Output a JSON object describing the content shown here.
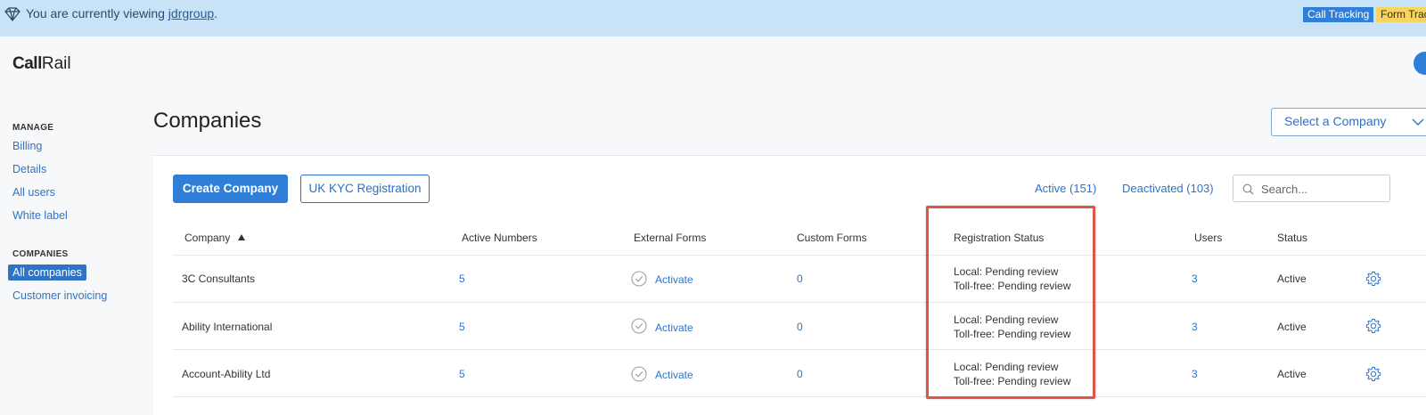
{
  "banner": {
    "prefix": "You are currently viewing",
    "account": "jdrgroup",
    "suffix": ".",
    "tags": [
      "Call Tracking",
      "Form Trac"
    ]
  },
  "brand": {
    "logo_bold": "Call",
    "logo_light": "Rail"
  },
  "sidebar": {
    "manage_heading": "MANAGE",
    "manage_items": [
      "Billing",
      "Details",
      "All users",
      "White label"
    ],
    "companies_heading": "COMPANIES",
    "companies_items": [
      "All companies",
      "Customer invoicing"
    ],
    "active_item": "All companies"
  },
  "page": {
    "title": "Companies",
    "company_select": "Select a Company"
  },
  "toolbar": {
    "create_label": "Create Company",
    "kyc_label": "UK KYC Registration",
    "tab_active": "Active (151)",
    "tab_deactivated": "Deactivated (103)",
    "search_placeholder": "Search..."
  },
  "table": {
    "columns": [
      "Company",
      "Active Numbers",
      "External Forms",
      "Custom Forms",
      "Registration Status",
      "Users",
      "Status"
    ],
    "sort_column": "Company",
    "rows": [
      {
        "company": "3C Consultants",
        "active_numbers": "5",
        "external_forms": "Activate",
        "custom_forms": "0",
        "registration_local": "Local: Pending review",
        "registration_tollfree": "Toll-free: Pending review",
        "users": "3",
        "status": "Active"
      },
      {
        "company": "Ability International",
        "active_numbers": "5",
        "external_forms": "Activate",
        "custom_forms": "0",
        "registration_local": "Local: Pending review",
        "registration_tollfree": "Toll-free: Pending review",
        "users": "3",
        "status": "Active"
      },
      {
        "company": "Account-Ability Ltd",
        "active_numbers": "5",
        "external_forms": "Activate",
        "custom_forms": "0",
        "registration_local": "Local: Pending review",
        "registration_tollfree": "Toll-free: Pending review",
        "users": "3",
        "status": "Active"
      }
    ]
  },
  "colors": {
    "accent": "#2f7fd8",
    "link": "#2f73c6",
    "banner_bg": "#c8e3f8",
    "highlight": "#e0554a",
    "tag_yellow": "#f7d560"
  },
  "icons": {
    "banner": "diamond-icon",
    "search": "search-icon",
    "check": "check-circle-icon",
    "settings": "gear-icon",
    "dropdown": "chevron-down-icon"
  }
}
